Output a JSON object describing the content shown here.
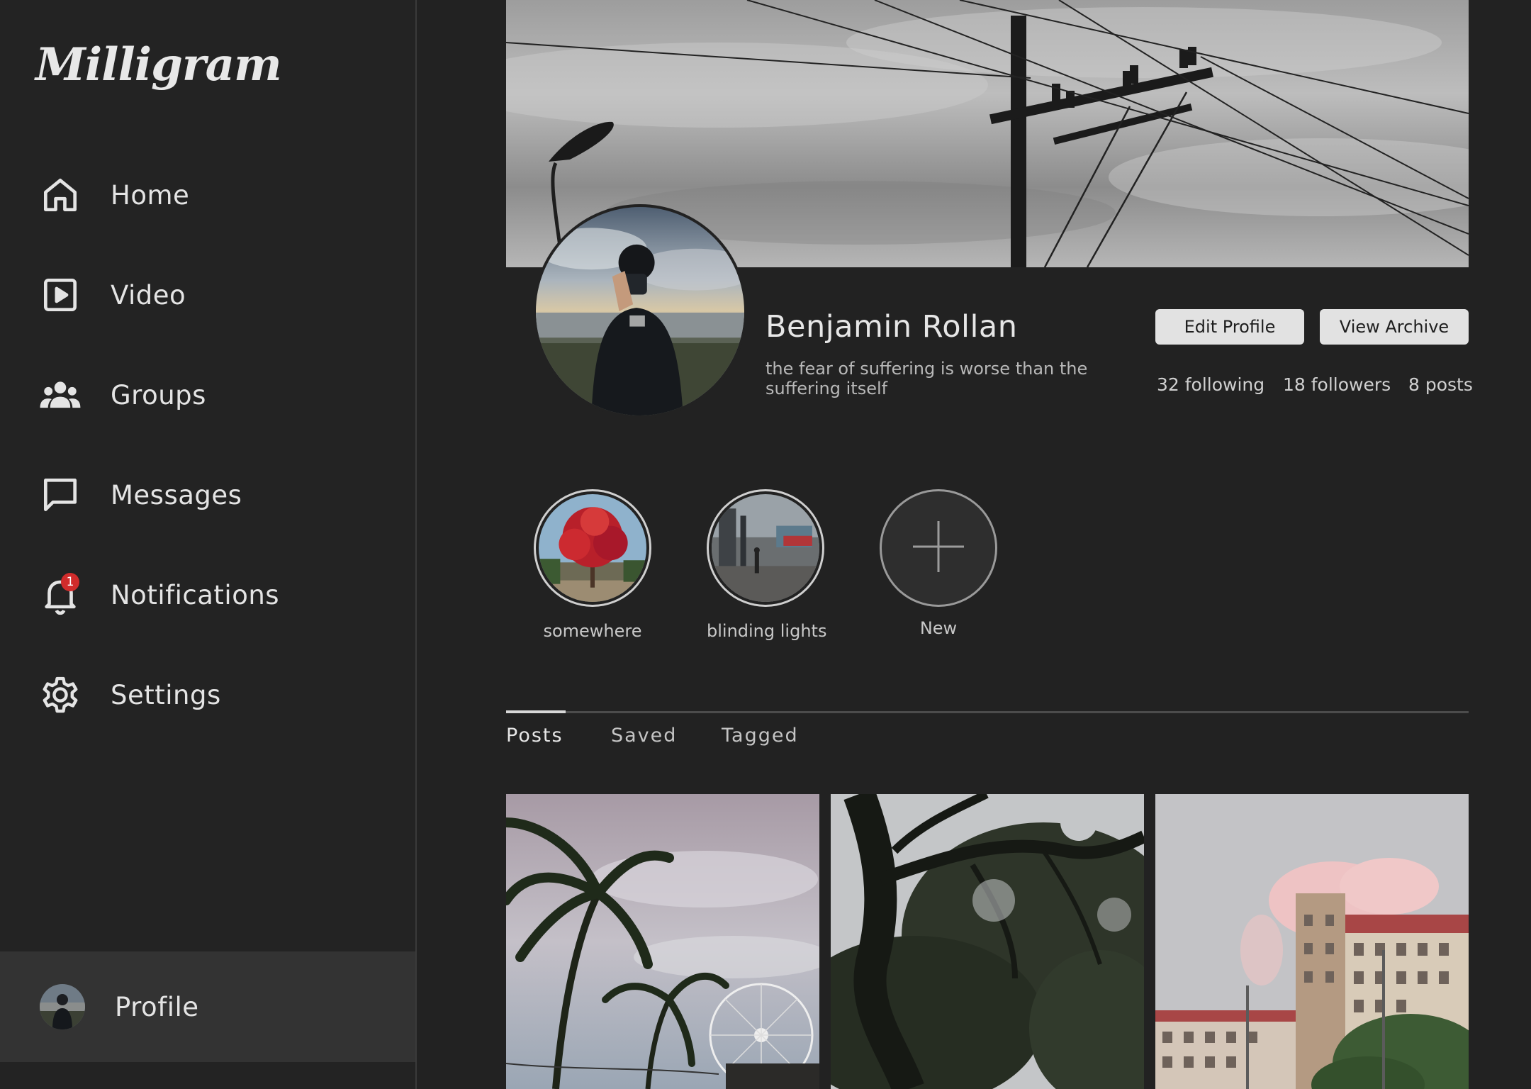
{
  "app": {
    "logo_text": "Milligram"
  },
  "sidebar": {
    "items": [
      {
        "label": "Home",
        "icon": "home-icon"
      },
      {
        "label": "Video",
        "icon": "video-icon"
      },
      {
        "label": "Groups",
        "icon": "groups-icon"
      },
      {
        "label": "Messages",
        "icon": "message-icon"
      },
      {
        "label": "Notifications",
        "icon": "bell-icon",
        "badge": "1"
      },
      {
        "label": "Settings",
        "icon": "gear-icon"
      }
    ],
    "profile": {
      "label": "Profile",
      "active": true
    }
  },
  "profile": {
    "name": "Benjamin Rollan",
    "bio": "the fear of suffering is worse than the suffering itself",
    "buttons": {
      "edit": "Edit Profile",
      "archive": "View Archive"
    },
    "stats": {
      "following": "32 following",
      "followers": "18 followers",
      "posts": "8 posts"
    }
  },
  "highlights": [
    {
      "label": "somewhere"
    },
    {
      "label": "blinding lights"
    },
    {
      "label": "New",
      "icon": "plus-icon"
    }
  ],
  "tabs": [
    {
      "label": "Posts",
      "active": true
    },
    {
      "label": "Saved",
      "active": false
    },
    {
      "label": "Tagged",
      "active": false
    }
  ],
  "colors": {
    "background": "#222222",
    "sidebar_active": "#333333",
    "badge": "#d12c2c",
    "button": "#e2e2e2"
  }
}
